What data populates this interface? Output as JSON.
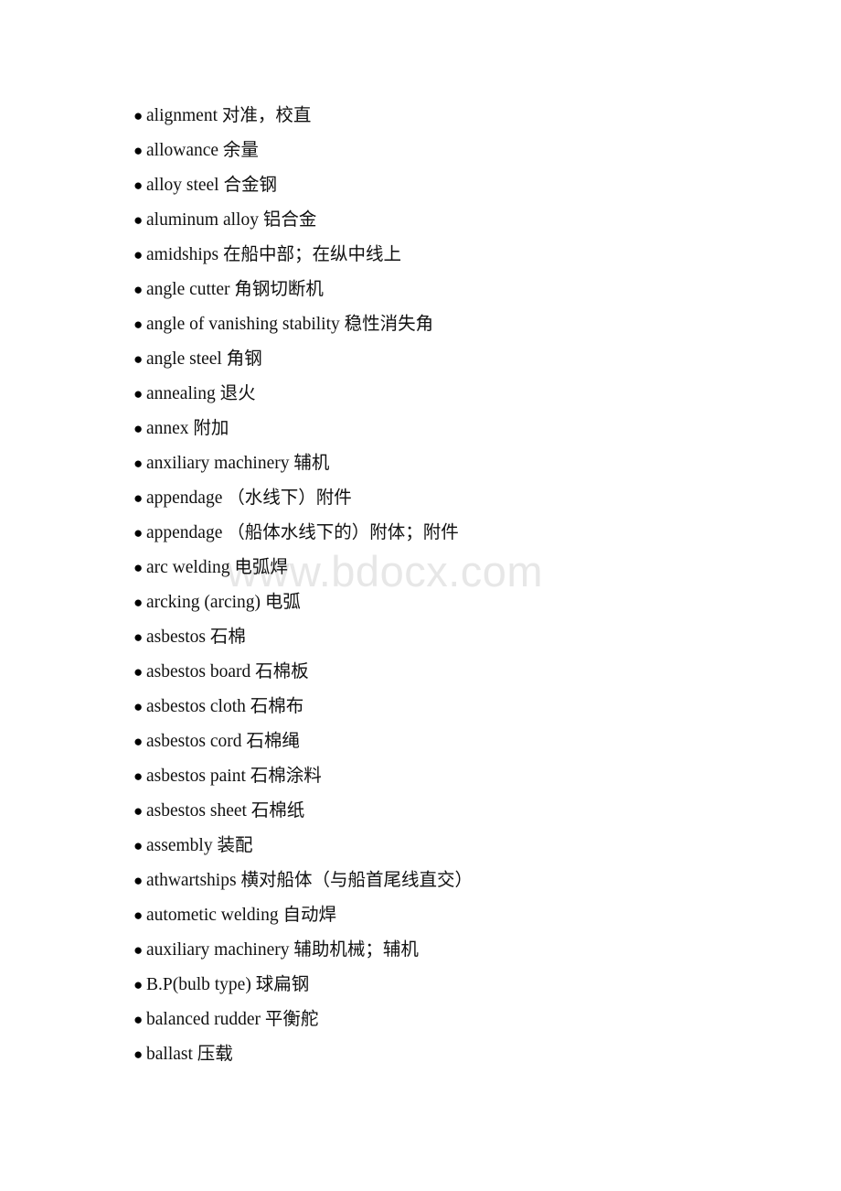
{
  "document": {
    "type": "glossary-list",
    "language_pair": "English-Chinese",
    "bullet_glyph": "●",
    "watermark": {
      "text": "www.bdocx.com",
      "color": "#e7e7e7"
    },
    "entries": [
      {
        "text": "alignment 对准，校直"
      },
      {
        "text": "allowance 余量"
      },
      {
        "text": "alloy steel 合金钢"
      },
      {
        "text": "aluminum alloy 铝合金"
      },
      {
        "text": "amidships 在船中部；在纵中线上"
      },
      {
        "text": "angle cutter 角钢切断机"
      },
      {
        "text": "angle of vanishing stability 稳性消失角"
      },
      {
        "text": "angle steel 角钢"
      },
      {
        "text": "annealing 退火"
      },
      {
        "text": "annex 附加"
      },
      {
        "text": "anxiliary machinery 辅机"
      },
      {
        "text": "appendage （水线下）附件"
      },
      {
        "text": "appendage （船体水线下的）附体；附件"
      },
      {
        "text": "arc welding 电弧焊"
      },
      {
        "text": "arcking (arcing) 电弧"
      },
      {
        "text": "asbestos 石棉"
      },
      {
        "text": "asbestos board 石棉板"
      },
      {
        "text": "asbestos cloth 石棉布"
      },
      {
        "text": "asbestos cord 石棉绳"
      },
      {
        "text": "asbestos paint 石棉涂料"
      },
      {
        "text": "asbestos sheet 石棉纸"
      },
      {
        "text": "assembly 装配"
      },
      {
        "text": "athwartships 横对船体（与船首尾线直交）"
      },
      {
        "text": "autometic welding 自动焊"
      },
      {
        "text": "auxiliary machinery 辅助机械；辅机"
      },
      {
        "text": "B.P(bulb type) 球扁钢"
      },
      {
        "text": "balanced rudder 平衡舵"
      },
      {
        "text": "ballast 压载"
      }
    ]
  }
}
